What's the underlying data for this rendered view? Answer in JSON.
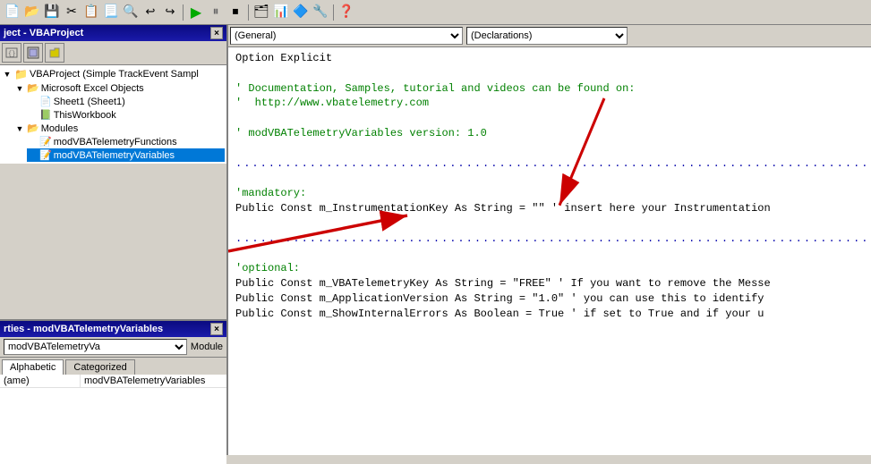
{
  "toolbar": {
    "icons": [
      "✂",
      "📋",
      "📃",
      "↩",
      "↪",
      "▶",
      "⏸",
      "⏹",
      "🔷",
      "📊",
      "🔧",
      "❓"
    ]
  },
  "project_explorer": {
    "title": "ject - VBAProject",
    "close_label": "×",
    "tree": [
      {
        "id": "vbaproject",
        "label": "VBAProject (Simple TrackEvent Sampl",
        "level": 0,
        "icon": "📁",
        "expanded": true
      },
      {
        "id": "excel_objects",
        "label": "Microsoft Excel Objects",
        "level": 1,
        "icon": "📂",
        "expanded": true
      },
      {
        "id": "sheet1",
        "label": "Sheet1 (Sheet1)",
        "level": 2,
        "icon": "📄"
      },
      {
        "id": "thisworkbook",
        "label": "ThisWorkbook",
        "level": 2,
        "icon": "📗"
      },
      {
        "id": "modules",
        "label": "Modules",
        "level": 1,
        "icon": "📂",
        "expanded": true
      },
      {
        "id": "modfunctions",
        "label": "modVBATelemetryFunctions",
        "level": 2,
        "icon": "📝"
      },
      {
        "id": "modvariables",
        "label": "modVBATelemetryVariables",
        "level": 2,
        "icon": "📝",
        "selected": true
      }
    ]
  },
  "properties_panel": {
    "title": "rties - modVBATelemetryVariables",
    "close_label": "×",
    "dropdown_value": "modVBATelemetryVa",
    "dropdown_type": "Module",
    "tabs": [
      "Alphabetic",
      "Categorized"
    ],
    "active_tab": "Alphabetic",
    "rows": [
      {
        "name": "(ame)",
        "value": "modVBATelemetryVariables"
      }
    ]
  },
  "code_editor": {
    "dropdown_general": "(General)",
    "dropdown_declarations": "(Declarations)",
    "lines": [
      {
        "type": "normal",
        "text": "Option Explicit"
      },
      {
        "type": "empty"
      },
      {
        "type": "comment",
        "text": "' Documentation, Samples, tutorial and videos can be found on:"
      },
      {
        "type": "comment",
        "text": "'  http://www.vbatelemetry.com"
      },
      {
        "type": "empty"
      },
      {
        "type": "comment",
        "text": "' modVBATelemetryVariables version: 1.0"
      },
      {
        "type": "empty"
      },
      {
        "type": "dotted",
        "text": "..............................................................................................................."
      },
      {
        "type": "empty"
      },
      {
        "type": "comment",
        "text": "'mandatory:"
      },
      {
        "type": "normal",
        "text": "Public Const m_InstrumentationKey As String = \"\" ' insert here your Instrumentation"
      },
      {
        "type": "empty"
      },
      {
        "type": "dotted",
        "text": "..............................................................................................................."
      },
      {
        "type": "empty"
      },
      {
        "type": "comment",
        "text": "'optional:"
      },
      {
        "type": "normal",
        "text": "Public Const m_VBATelemetryKey As String = \"FREE\" ' If you want to remove the Messe"
      },
      {
        "type": "normal",
        "text": "Public Const m_ApplicationVersion As String = \"1.0\" ' you can use this to identify"
      },
      {
        "type": "normal",
        "text": "Public Const m_ShowInternalErrors As Boolean = True ' if set to True and if your u"
      }
    ]
  }
}
